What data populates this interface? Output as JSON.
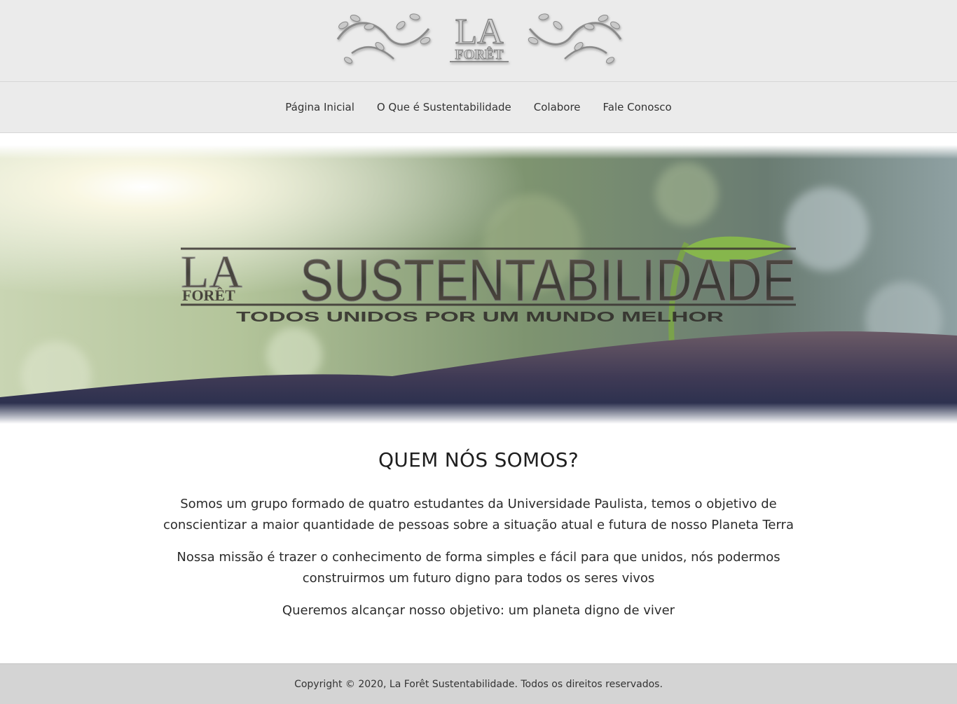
{
  "header": {
    "logo": {
      "icon": "la-foret-vine-logo",
      "text_top": "LA",
      "text_bottom": "FORÊT"
    }
  },
  "nav": {
    "items": [
      {
        "label": "Página Inicial"
      },
      {
        "label": "O Que é Sustentabilidade"
      },
      {
        "label": "Colabore"
      },
      {
        "label": "Fale Conosco"
      }
    ]
  },
  "hero": {
    "logo_top": "LA",
    "logo_bottom": "FORÊT",
    "title": "SUSTENTABILIDADE",
    "tagline": "TODOS UNIDOS POR UM MUNDO MELHOR"
  },
  "about": {
    "heading": "QUEM NÓS SOMOS?",
    "paragraphs": [
      "Somos um grupo formado de quatro estudantes da Universidade Paulista, temos o objetivo de conscientizar a maior quantidade de pessoas sobre a situação atual e futura de nosso Planeta Terra",
      "Nossa missão é trazer o conhecimento de forma simples e fácil para que unidos, nós podermos construirmos um futuro digno para todos os seres vivos",
      "Queremos alcançar nosso objetivo: um planeta digno de viver"
    ]
  },
  "footer": {
    "text": "Copyright © 2020, La Forêt Sustentabilidade. Todos os direitos reservados."
  },
  "colors": {
    "header_bg": "#ebebeb",
    "footer_bg": "#d4d4d4",
    "text": "#222222"
  }
}
